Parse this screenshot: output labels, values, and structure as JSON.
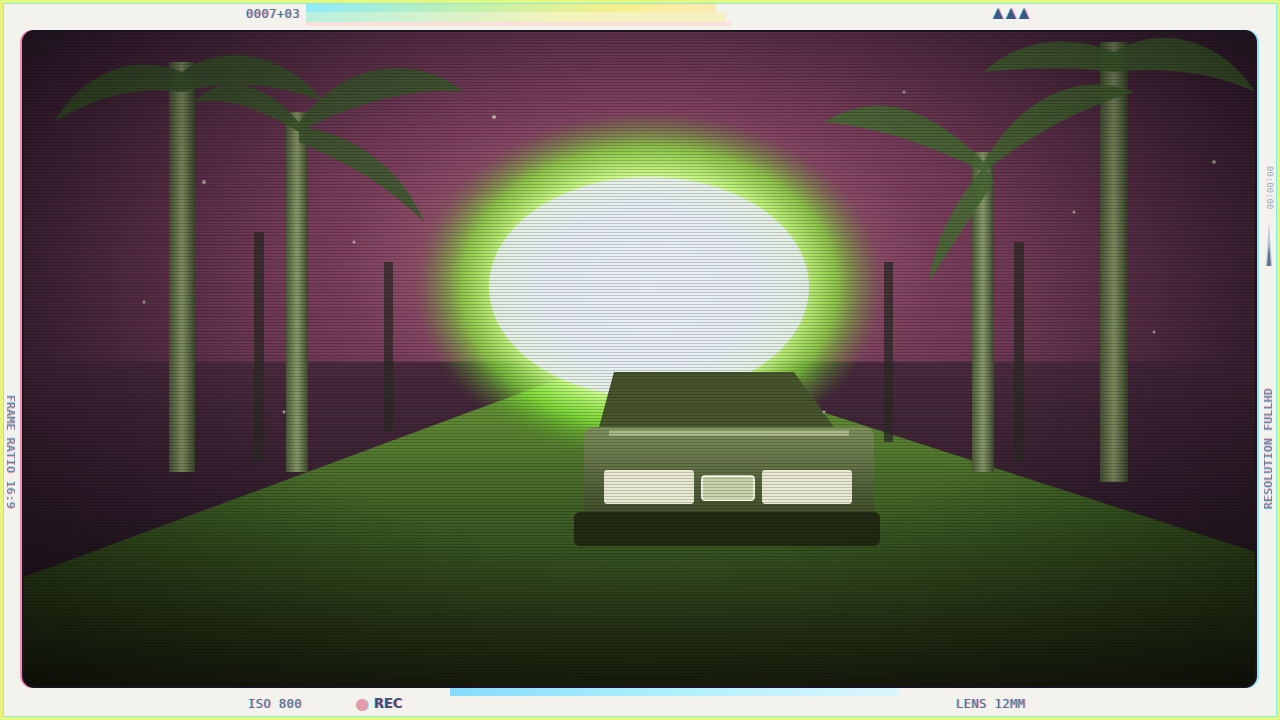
{
  "hud": {
    "timecode": "0007+03",
    "iso": "ISO 800",
    "rec_label": "REC",
    "lens": "LENS 12MM",
    "frame_ratio": "FRAME RATIO 16:9",
    "resolution": "RESOLUTION FULLHD",
    "vertical_timecode": "00:00:00"
  },
  "colors": {
    "frame_border": "#e9f57a",
    "hud_text": "#5a6e86",
    "rec_dot": "#e59aa8",
    "sky": "#6b3a55",
    "glow": "#b8ff6a",
    "road": "#3b5a22"
  },
  "icons": {
    "battery_indicator": "triangle-signal-icon",
    "rec_indicator": "record-dot-icon"
  }
}
